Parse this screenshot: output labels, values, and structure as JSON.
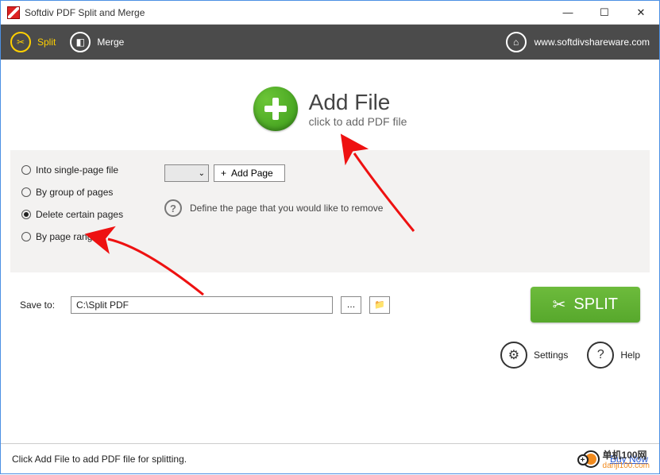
{
  "window": {
    "title": "Softdiv PDF Split and Merge"
  },
  "toolbar": {
    "split_label": "Split",
    "merge_label": "Merge",
    "website": "www.softdivshareware.com"
  },
  "addfile": {
    "title": "Add File",
    "subtitle": "click to add PDF file"
  },
  "options": {
    "radios": [
      "Into single-page file",
      "By group of pages",
      "Delete certain pages",
      "By page range"
    ],
    "selected_index": 2,
    "addpage_label": "Add Page",
    "hint": "Define the page that you would like to remove"
  },
  "save": {
    "label": "Save to:",
    "path": "C:\\Split PDF",
    "split_button": "SPLIT"
  },
  "footer": {
    "settings_label": "Settings",
    "help_label": "Help"
  },
  "status": {
    "text": "Click Add File to add PDF file for splitting.",
    "buy": "Buy Now"
  },
  "watermark": {
    "brand_cn": "单机100网",
    "brand_url": "danji100.com"
  }
}
